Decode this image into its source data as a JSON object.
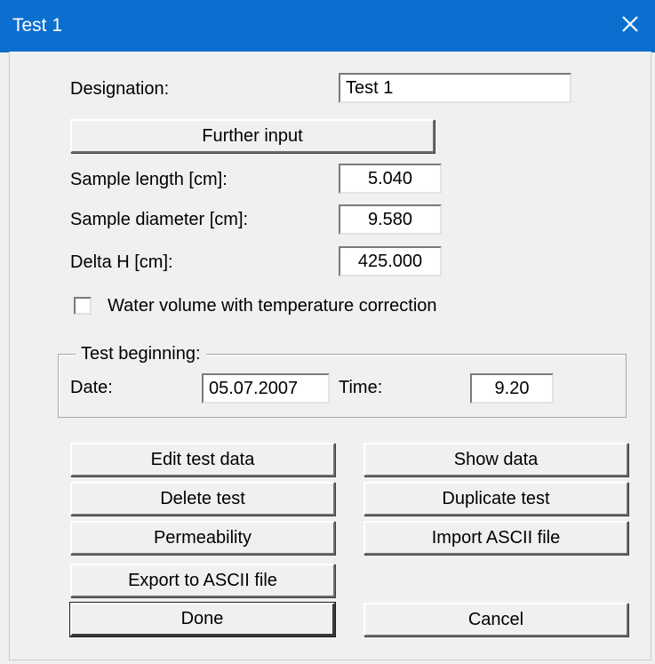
{
  "window": {
    "title": "Test 1",
    "close_icon": "close-icon"
  },
  "form": {
    "designation_label": "Designation:",
    "designation_value": "Test 1",
    "further_input_label": "Further input",
    "sample_length_label": "Sample length [cm]:",
    "sample_length_value": "5.040",
    "sample_diameter_label": "Sample diameter [cm]:",
    "sample_diameter_value": "9.580",
    "delta_h_label": "Delta H [cm]:",
    "delta_h_value": "425.000",
    "water_volume_label": "Water volume with temperature correction",
    "water_volume_checked": false
  },
  "test_beginning": {
    "legend": "Test beginning:",
    "date_label": "Date:",
    "date_value": "05.07.2007",
    "time_label": "Time:",
    "time_value": "9.20"
  },
  "buttons": {
    "edit_test_data": "Edit test data",
    "show_data": "Show data",
    "delete_test": "Delete test",
    "duplicate_test": "Duplicate test",
    "permeability": "Permeability",
    "import_ascii": "Import ASCII file",
    "export_ascii": "Export to ASCII file",
    "done": "Done",
    "cancel": "Cancel"
  }
}
